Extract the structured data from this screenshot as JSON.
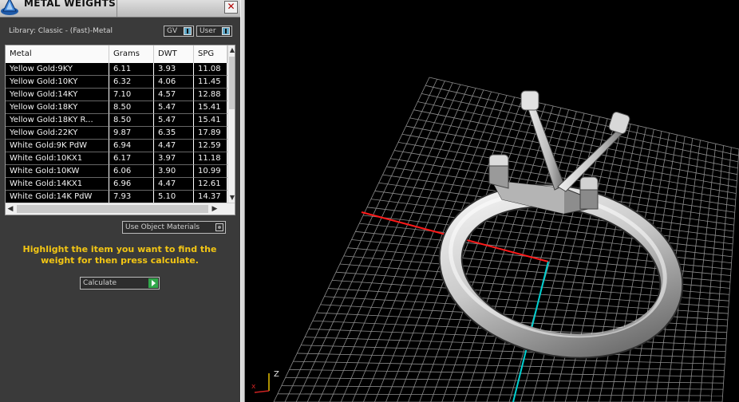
{
  "window": {
    "title": "METAL WEIGHTS",
    "close_label": "✕"
  },
  "library": {
    "label": "Library: Classic - (Fast)-Metal",
    "toggles": [
      {
        "label": "GV"
      },
      {
        "label": "User"
      }
    ]
  },
  "table": {
    "columns": [
      "Metal",
      "Grams",
      "DWT",
      "SPG"
    ],
    "rows": [
      [
        "Yellow Gold:9KY",
        "6.11",
        "3.93",
        "11.08"
      ],
      [
        "Yellow Gold:10KY",
        "6.32",
        "4.06",
        "11.45"
      ],
      [
        "Yellow Gold:14KY",
        "7.10",
        "4.57",
        "12.88"
      ],
      [
        "Yellow Gold:18KY",
        "8.50",
        "5.47",
        "15.41"
      ],
      [
        "Yellow Gold:18KY R...",
        "8.50",
        "5.47",
        "15.41"
      ],
      [
        "Yellow Gold:22KY",
        "9.87",
        "6.35",
        "17.89"
      ],
      [
        "White Gold:9K PdW",
        "6.94",
        "4.47",
        "12.59"
      ],
      [
        "White Gold:10KX1",
        "6.17",
        "3.97",
        "11.18"
      ],
      [
        "White Gold:10KW",
        "6.06",
        "3.90",
        "10.99"
      ],
      [
        "White Gold:14KX1",
        "6.96",
        "4.47",
        "12.61"
      ],
      [
        "White Gold:14K PdW",
        "7.93",
        "5.10",
        "14.37"
      ]
    ]
  },
  "use_object_materials_label": "Use Object Materials",
  "hint": "Highlight the item you want to find the weight for then press calculate.",
  "calculate_label": "Calculate",
  "viewport": {
    "axis_label": "Z",
    "background": "#000000",
    "grid_color": "#8c8c8c",
    "x_axis_color": "#ff1a1a",
    "y_axis_color": "#00d0d0"
  },
  "colors": {
    "panel_bg": "#3a3a3a",
    "hint_text": "#f3c614",
    "toggle_knob": "#5fa8c8",
    "calc_go": "#31a84b"
  }
}
